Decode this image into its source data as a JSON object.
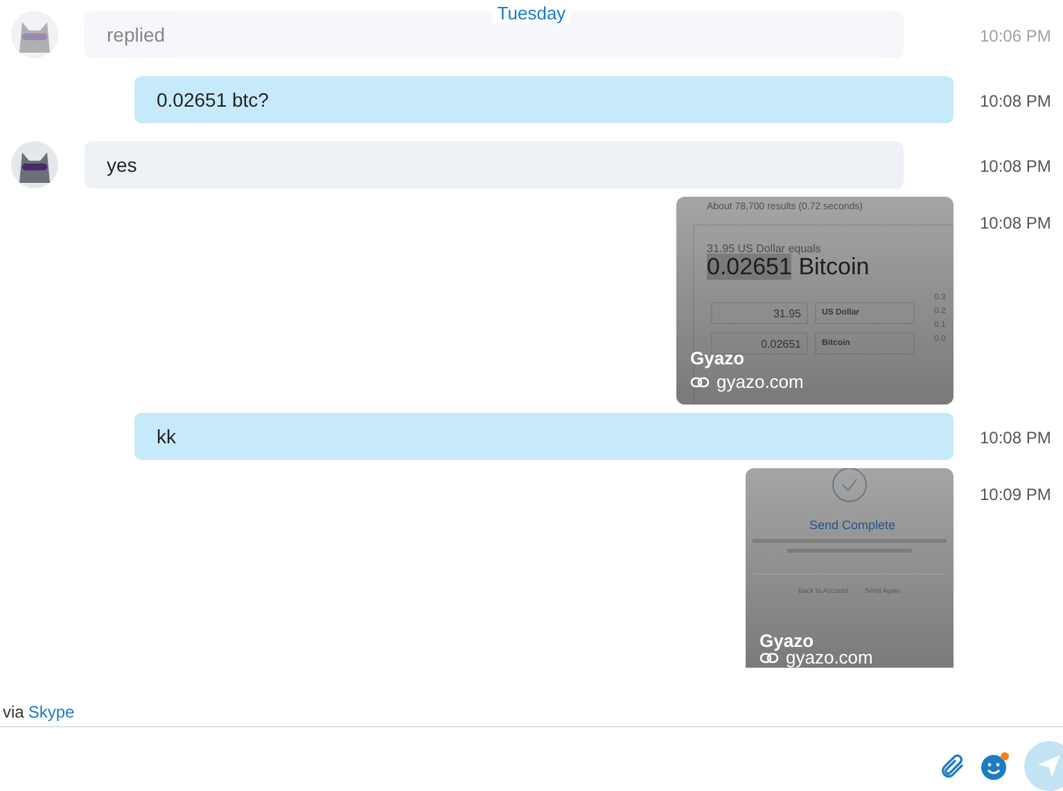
{
  "date_divider": "Tuesday",
  "messages": [
    {
      "kind": "incoming",
      "faded": true,
      "text": "replied",
      "time": "10:06 PM"
    },
    {
      "kind": "outgoing",
      "faded": false,
      "text": "0.02651 btc?",
      "time": "10:08 PM"
    },
    {
      "kind": "incoming",
      "faded": false,
      "text": "yes",
      "time": "10:08 PM"
    },
    {
      "kind": "preview",
      "faded": false,
      "time": "10:08 PM",
      "site": "Gyazo",
      "url": "gyazo.com",
      "shot": {
        "kind": "converter",
        "stats": "About 78,700 results (0.72 seconds)",
        "equals": "31.95 US Dollar equals",
        "amount": "0.02651",
        "unit": "Bitcoin",
        "rows": [
          {
            "value": "31.95",
            "currency": "US Dollar"
          },
          {
            "value": "0.02651",
            "currency": "Bitcoin"
          }
        ],
        "ticks": [
          "0.3",
          "0.2",
          "0.1",
          "0.0"
        ]
      }
    },
    {
      "kind": "outgoing",
      "faded": false,
      "text": "kk",
      "time": "10:08 PM"
    },
    {
      "kind": "preview",
      "faded": false,
      "time": "10:09 PM",
      "site": "Gyazo",
      "url": "gyazo.com",
      "shot": {
        "kind": "send_complete",
        "title": "Send Complete",
        "links": [
          "Back to Account",
          "Send Again"
        ]
      }
    }
  ],
  "via": {
    "prefix": "via",
    "link": "Skype"
  }
}
